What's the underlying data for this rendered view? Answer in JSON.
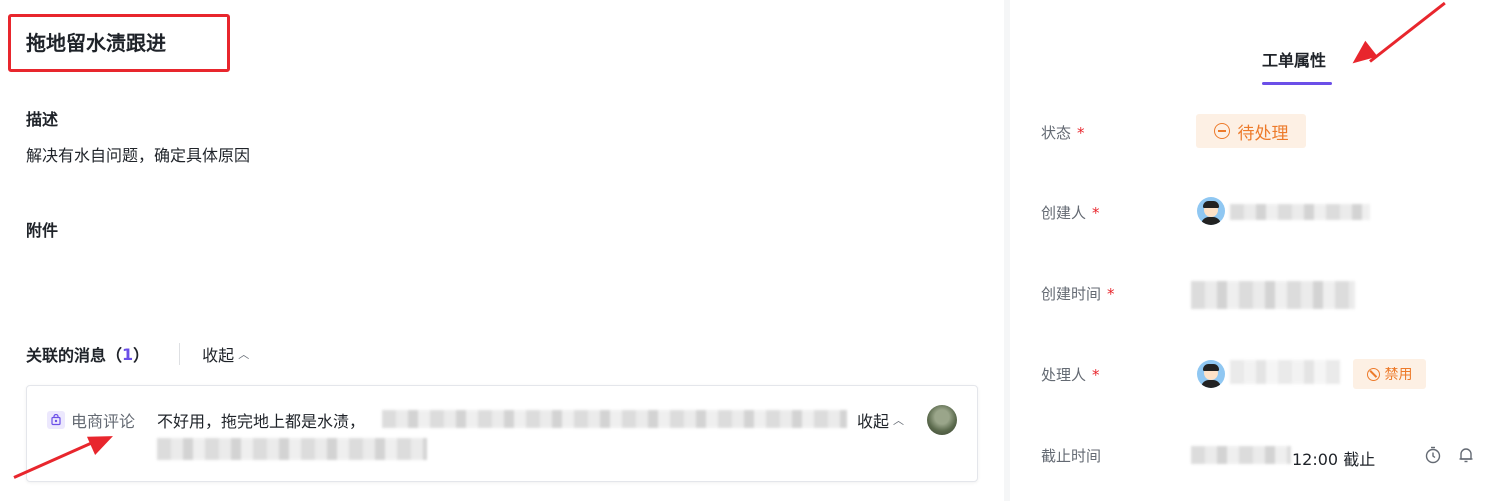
{
  "task": {
    "title": "拖地留水渍跟进",
    "description_label": "描述",
    "description": "解决有水自问题，确定具体原因",
    "attachments_label": "附件"
  },
  "related": {
    "title": "关联的消息（",
    "count": "1",
    "title_close": "）",
    "collapse_label": "收起",
    "message": {
      "source_icon": "ecommerce-bag-icon",
      "source": "电商评论",
      "text": "不好用，拖完地上都是水渍，",
      "collapse_label": "收起"
    }
  },
  "properties": {
    "tab_label": "工单属性",
    "status": {
      "label": "状态",
      "required": "*",
      "value": "待处理",
      "icon": "minus-circle-icon"
    },
    "creator": {
      "label": "创建人",
      "required": "*"
    },
    "created_time": {
      "label": "创建时间",
      "required": "*"
    },
    "assignee": {
      "label": "处理人",
      "required": "*",
      "badge": "禁用",
      "badge_icon": "ban-icon"
    },
    "deadline": {
      "label": "截止时间",
      "value": "12:00 截止",
      "icons": [
        "timer-icon",
        "bell-icon"
      ]
    }
  },
  "colors": {
    "accent": "#6b4fe8",
    "warning": "#ed7a2a",
    "warning_bg": "#fdf0e4",
    "annotation_red": "#e8262d",
    "required": "#e8262d"
  }
}
